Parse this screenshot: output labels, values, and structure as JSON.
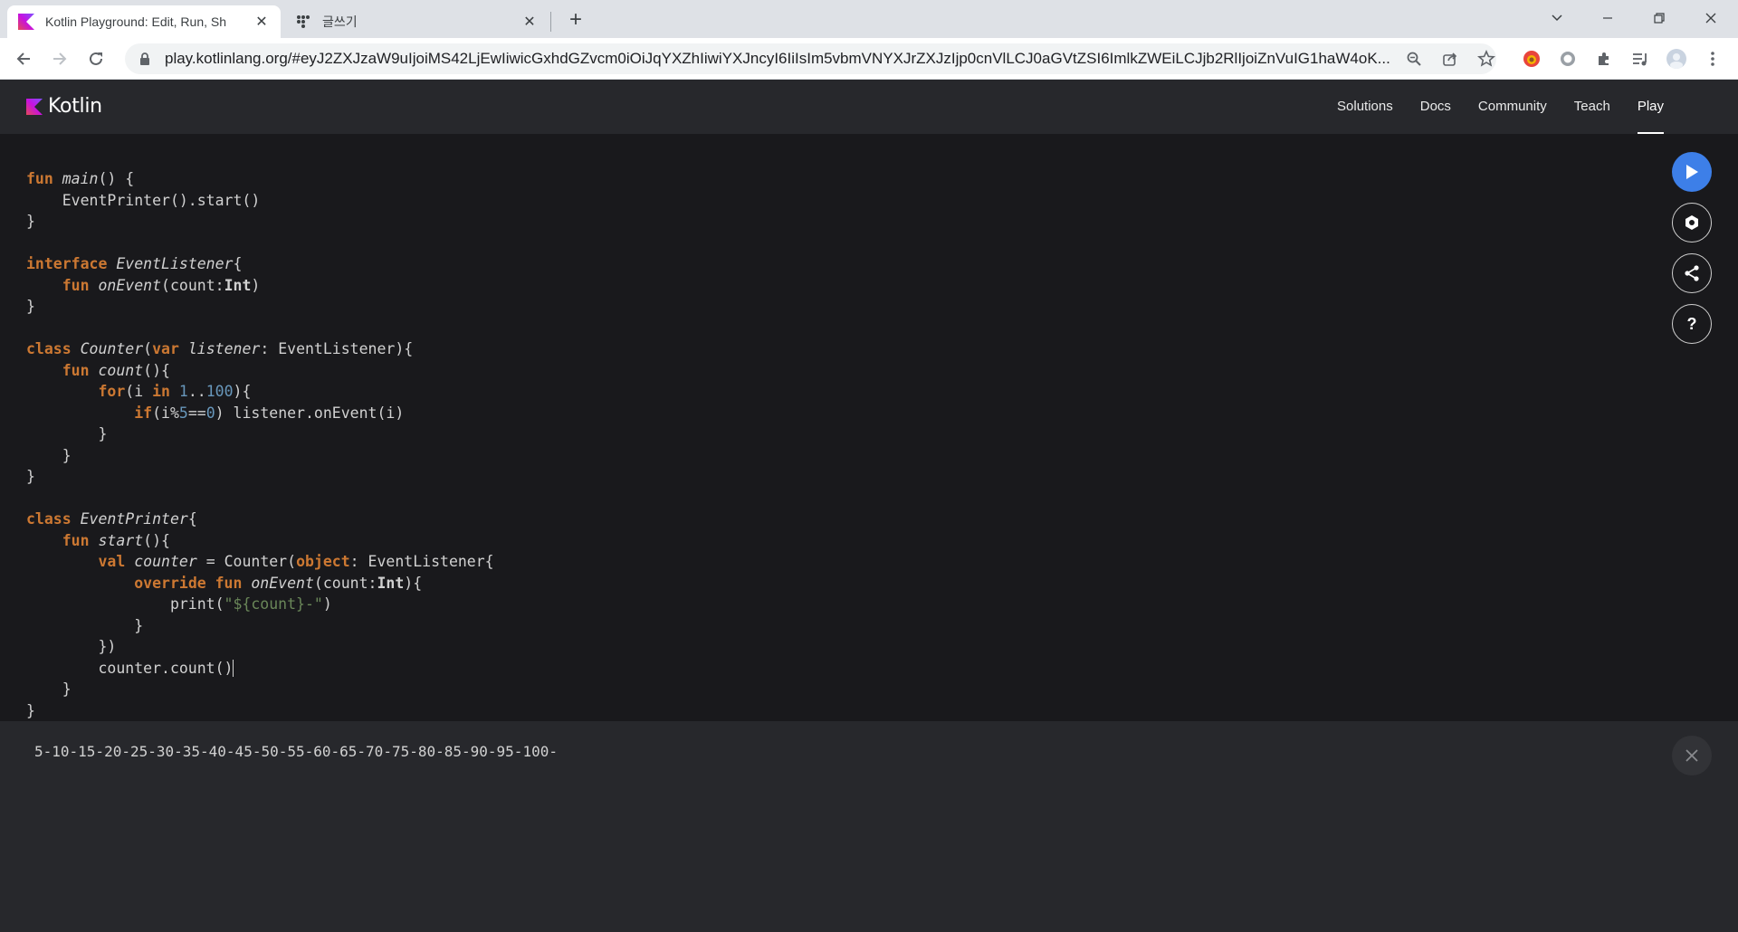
{
  "browser": {
    "tabs": [
      {
        "title": "Kotlin Playground: Edit, Run, Sh",
        "active": true
      },
      {
        "title": "글쓰기",
        "active": false
      }
    ],
    "url": "play.kotlinlang.org/#eyJ2ZXJzaW9uIjoiMS42LjEwIiwicGxhdGZvcm0iOiJqYXZhIiwiYXJncyI6IiIsIm5vbmVNYXJrZXJzIjp0cnVlLCJ0aGVtZSI6ImlkZWEiLCJjb2RlIjoiZnVuIG1haW4oK..."
  },
  "site": {
    "logo_text": "Kotlin",
    "nav": [
      "Solutions",
      "Docs",
      "Community",
      "Teach",
      "Play"
    ],
    "active_nav": "Play"
  },
  "editor": {
    "language": "Kotlin"
  },
  "output": {
    "text": "5-10-15-20-25-30-35-40-45-50-55-60-65-70-75-80-85-90-95-100-"
  },
  "colors": {
    "accent_run": "#3d7fe8",
    "keyword": "#cc7832",
    "number": "#6897bb",
    "string": "#6a8759",
    "kotlin_logo": "#7f52ff"
  },
  "icons": {
    "run": "play-icon",
    "settings": "gear-icon",
    "share": "share-icon",
    "help": "question-icon",
    "close": "close-icon"
  }
}
